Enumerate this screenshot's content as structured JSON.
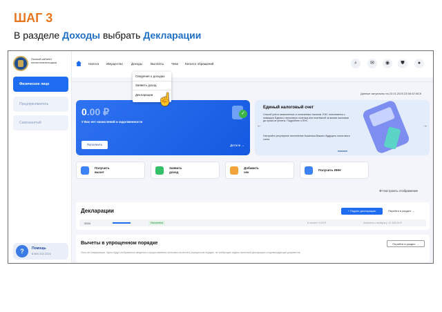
{
  "step_title": "ШАГ 3",
  "instruction": {
    "pre": "В разделе ",
    "section": "Доходы",
    "mid": " выбрать ",
    "target": "Декларации"
  },
  "sidebar": {
    "logo_text": "Личный кабинет налогоплательщика",
    "items": [
      {
        "label": "Физическое лицо"
      },
      {
        "label": "Предприниматель"
      },
      {
        "label": "Самозанятый"
      }
    ],
    "help_title": "Помощь",
    "help_phone": "8 800 222 2222"
  },
  "nav": {
    "items": [
      "Налоги",
      "Имущество",
      "Доходы",
      "Выплаты",
      "Чеки",
      "Каталог обращений"
    ],
    "dropdown": [
      "Сведения о доходах",
      "Заявить доход",
      "Декларации"
    ]
  },
  "updated_text": "Данные актуальны на 23.01.2025 23:58:43 МСК",
  "balance": {
    "amount": "0",
    "decimals": ".00 ₽",
    "subtitle": "У Вас нет начислений и задолженности",
    "pay_button": "Пополнить",
    "details": "Детали"
  },
  "ens": {
    "title": "Единый налоговый счет",
    "desc": "Способ учёта начисленных и оплаченных налогов. ЕНС пополняется с помощью Единого налогового платежа или платёжной за всеми налогами до срока их уплаты. Подробнее о ЕНС",
    "desc2": "Настройте регулярное пополнение Кошелька Вашего будущего налогового счета"
  },
  "quick": [
    {
      "label1": "Получить",
      "label2": "вычет",
      "color": "#3b82f6"
    },
    {
      "label1": "Заявить",
      "label2": "доход",
      "color": "#34c068"
    },
    {
      "label1": "Добавить",
      "label2": "чек",
      "color": "#f2a43a"
    },
    {
      "label1": "Получить ИНН",
      "label2": "",
      "color": "#3b82f6"
    }
  ],
  "settings_label": "Настроить отображение",
  "declarations": {
    "title": "Декларации",
    "create_button": "+ Подать декларацию",
    "goto": "Перейти в раздел",
    "row": {
      "year": "2024",
      "status": "Исполнено",
      "pay": "К оплате: 0.00 ₽",
      "refund": "Заявлено к возврату: 12 468.00 ₽"
    }
  },
  "simplified": {
    "title": "Вычеты в упрощенном порядке",
    "desc": "Пока нет информации. Здесь будут отображаться сведения о предоставлении налоговых вычетов в упрощенном порядке, не требующем подачи налоговой декларации и подтверждающих документов",
    "goto": "Перейти в раздел"
  }
}
